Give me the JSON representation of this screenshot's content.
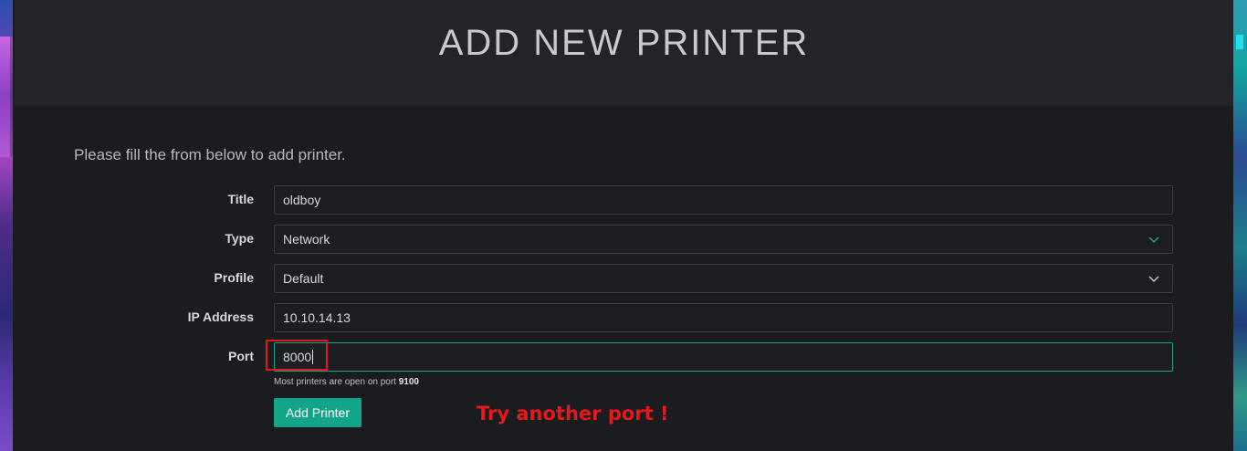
{
  "page": {
    "title": "ADD NEW PRINTER",
    "intro": "Please fill the from below to add printer."
  },
  "form": {
    "title": {
      "label": "Title",
      "value": "oldboy"
    },
    "type": {
      "label": "Type",
      "value": "Network",
      "icon": "chevron-down-icon",
      "icon_color": "#1aa389"
    },
    "profile": {
      "label": "Profile",
      "value": "Default",
      "icon": "chevron-down-icon",
      "icon_color": "#c7c8cb"
    },
    "ip_address": {
      "label": "IP Address",
      "value": "10.10.14.13"
    },
    "port": {
      "label": "Port",
      "value": "8000"
    },
    "port_hint_prefix": "Most printers are open on port",
    "port_hint_value": "9100",
    "submit_label": "Add Printer"
  },
  "annotation": {
    "text": "Try another port !",
    "color": "#e3191c"
  },
  "colors": {
    "accent": "#13a58a",
    "background": "#1b1c1f",
    "header": "#232427"
  }
}
